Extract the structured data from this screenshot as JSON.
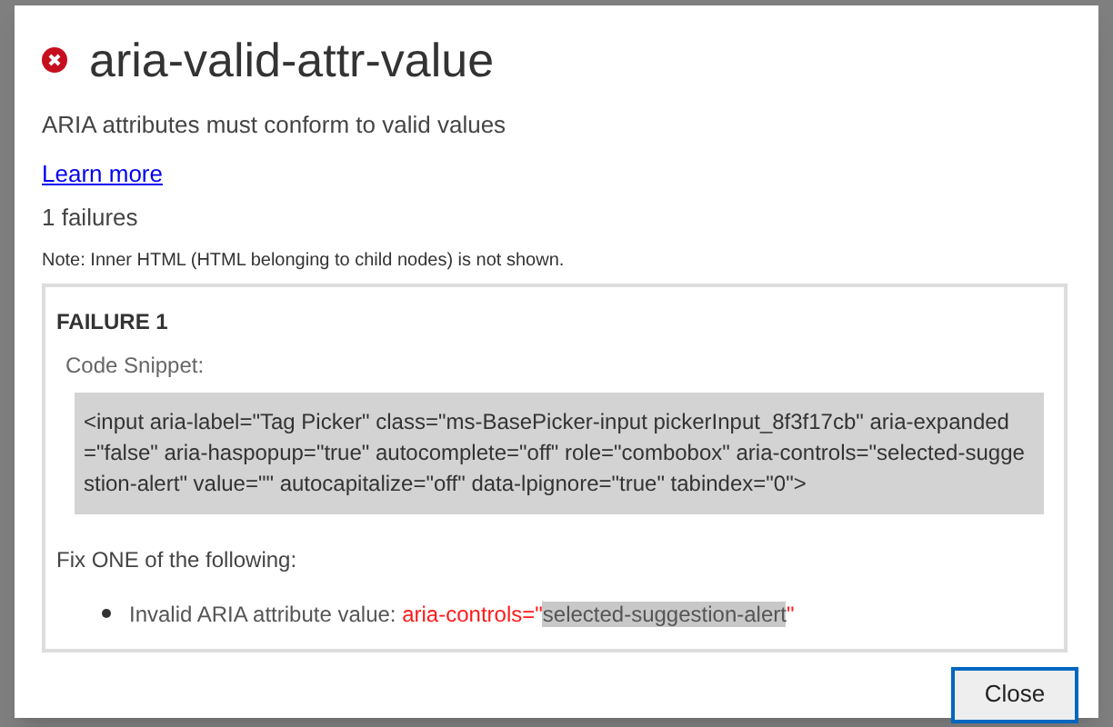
{
  "dialog": {
    "title": "aria-valid-attr-value",
    "description": "ARIA attributes must conform to valid values",
    "link": "Learn more",
    "count": "1 failures",
    "note": "Note: Inner HTML (HTML belonging to child nodes) is not shown.",
    "failures": [
      {
        "heading": "FAILURE 1",
        "snippet_label": "Code Snippet:",
        "snippet": "<input aria-label=\"Tag Picker\" class=\"ms-BasePicker-input pickerInput_8f3f17cb\" aria-expanded=\"false\" aria-haspopup=\"true\" autocomplete=\"off\" role=\"combobox\" aria-controls=\"selected-suggestion-alert\" value=\"\" autocapitalize=\"off\" data-lpignore=\"true\" tabindex=\"0\">",
        "fix_label": "Fix ONE of the following:",
        "fixes": [
          {
            "label": "Invalid ARIA attribute value: ",
            "attr_prefix": "aria-controls=\"",
            "attr_value": "selected-suggestion-alert",
            "attr_suffix": "\""
          }
        ]
      }
    ],
    "button": "Close"
  }
}
